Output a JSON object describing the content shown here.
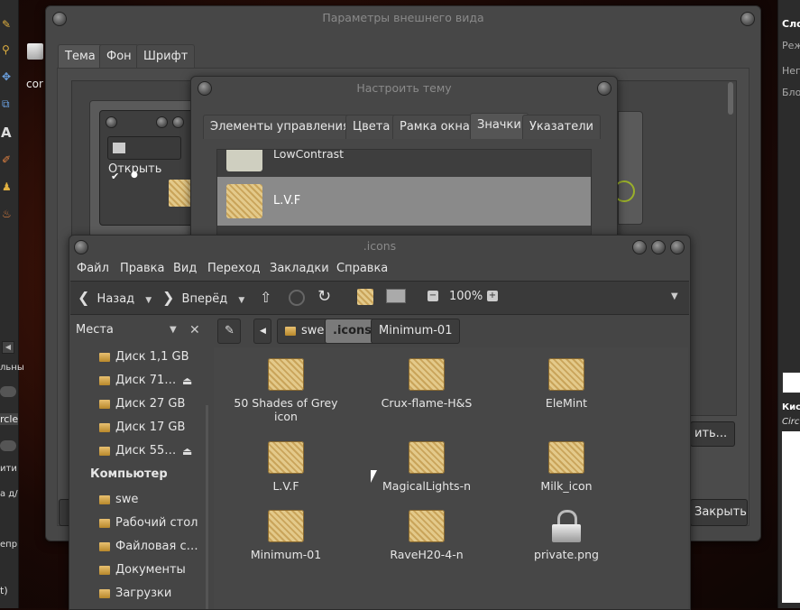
{
  "left_panel": {
    "labels": [
      "cor",
      "льны",
      "rcle",
      "ити",
      "а д/",
      "епр",
      "t)"
    ]
  },
  "right_panel": {
    "labels": [
      "Сло",
      "Реж",
      "Неп",
      "Бло",
      "Кис",
      "Circ"
    ]
  },
  "appearance": {
    "title": "Параметры внешнего вида",
    "tabs": [
      "Тема",
      "Фон",
      "Шрифт"
    ],
    "preview": {
      "open_label": "Открыть"
    },
    "partial_button": "ить...",
    "close_button": "Закрыть"
  },
  "theme_dialog": {
    "title": "Настроить тему",
    "tabs": [
      "Элементы управления",
      "Цвета",
      "Рамка окна",
      "Значки",
      "Указатели"
    ],
    "list": [
      {
        "name": "LowContrast"
      },
      {
        "name": "L.V.F",
        "selected": true
      }
    ]
  },
  "filemanager": {
    "title": ".icons",
    "menu": [
      "Файл",
      "Правка",
      "Вид",
      "Переход",
      "Закладки",
      "Справка"
    ],
    "toolbar": {
      "back": "Назад",
      "forward": "Вперёд",
      "zoom": "100%"
    },
    "sidebar": {
      "header": "Места",
      "devices": [
        {
          "label": "Диск 1,1 GB",
          "eject": false
        },
        {
          "label": "Диск 71…",
          "eject": true
        },
        {
          "label": "Диск 27 GB",
          "eject": false
        },
        {
          "label": "Диск 17 GB",
          "eject": false
        },
        {
          "label": "Диск 55…",
          "eject": true
        }
      ],
      "computer_header": "Компьютер",
      "places": [
        "swe",
        "Рабочий стол",
        "Файловая с…",
        "Документы",
        "Загрузки"
      ]
    },
    "breadcrumbs": [
      "swe",
      ".icons",
      "Minimum-01"
    ],
    "files": [
      {
        "name": "50 Shades of Grey icon",
        "type": "folder"
      },
      {
        "name": "Crux-flame-H&S",
        "type": "folder"
      },
      {
        "name": "EleMint",
        "type": "folder"
      },
      {
        "name": "L.V.F",
        "type": "folder"
      },
      {
        "name": "MagicalLights-n",
        "type": "folder"
      },
      {
        "name": "Milk_icon",
        "type": "folder"
      },
      {
        "name": "Minimum-01",
        "type": "folder"
      },
      {
        "name": "RaveH20-4-n",
        "type": "folder"
      },
      {
        "name": "private.png",
        "type": "lock"
      }
    ]
  }
}
